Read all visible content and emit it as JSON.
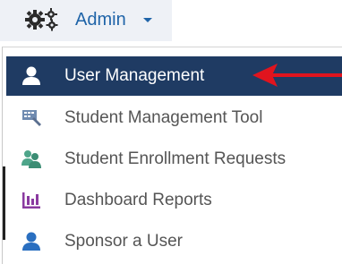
{
  "nav": {
    "toggle_label": "Admin"
  },
  "menu": {
    "items": [
      {
        "label": "User Management",
        "icon": "user-icon",
        "active": true
      },
      {
        "label": "Student Management Tool",
        "icon": "student-tool-icon",
        "active": false
      },
      {
        "label": "Student Enrollment Requests",
        "icon": "users-icon",
        "active": false
      },
      {
        "label": "Dashboard Reports",
        "icon": "bar-chart-icon",
        "active": false
      },
      {
        "label": "Sponsor a User",
        "icon": "user-icon",
        "active": false
      }
    ]
  },
  "colors": {
    "accent": "#1f64a8",
    "active_bg": "#1f3b63",
    "annotation_arrow": "#e0141e"
  }
}
